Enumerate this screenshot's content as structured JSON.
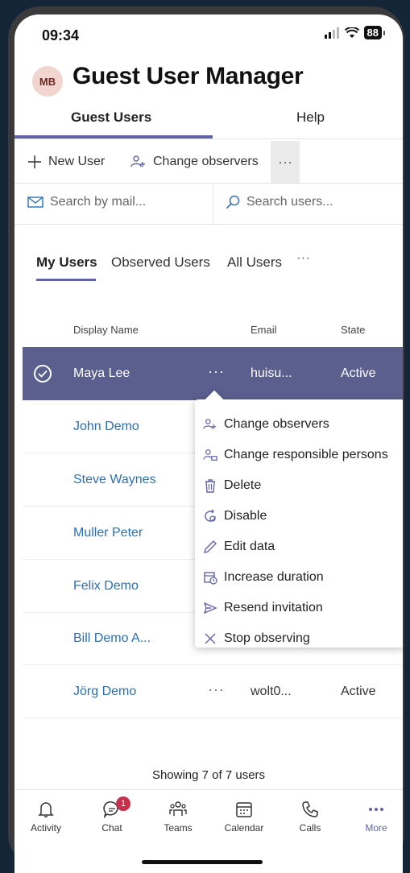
{
  "status": {
    "time": "09:34",
    "battery": "88"
  },
  "header": {
    "avatar_initials": "MB",
    "title": "Guest User Manager"
  },
  "main_tabs": [
    {
      "label": "Guest Users"
    },
    {
      "label": "Help"
    }
  ],
  "toolbar": {
    "new_user": "New User",
    "change_observers": "Change observers",
    "more": "···"
  },
  "search": {
    "mail_placeholder": "Search by mail...",
    "users_placeholder": "Search users..."
  },
  "sub_tabs": [
    {
      "label": "My Users"
    },
    {
      "label": "Observed Users"
    },
    {
      "label": "All Users"
    },
    {
      "label": "···"
    }
  ],
  "table": {
    "headers": {
      "name": "Display Name",
      "email": "Email",
      "state": "State"
    },
    "rows": [
      {
        "name": "Maya Lee",
        "dots": "···",
        "email": "huisu...",
        "state": "Active"
      },
      {
        "name": "John Demo"
      },
      {
        "name": "Steve Waynes"
      },
      {
        "name": "Muller Peter"
      },
      {
        "name": "Felix Demo"
      },
      {
        "name": "Bill Demo A..."
      },
      {
        "name": "Jörg Demo",
        "dots": "···",
        "email": "wolt0...",
        "state": "Active"
      }
    ]
  },
  "context_menu": [
    {
      "label": "Change observers",
      "icon": "people-add-icon"
    },
    {
      "label": "Change responsible persons",
      "icon": "person-key-icon"
    },
    {
      "label": "Delete",
      "icon": "trash-icon"
    },
    {
      "label": "Disable",
      "icon": "disable-icon"
    },
    {
      "label": "Edit data",
      "icon": "pencil-icon"
    },
    {
      "label": "Increase duration",
      "icon": "calendar-clock-icon"
    },
    {
      "label": "Resend invitation",
      "icon": "send-icon"
    },
    {
      "label": "Stop observing",
      "icon": "close-icon"
    }
  ],
  "footer": {
    "showing": "Showing 7 of 7 users"
  },
  "bottom_nav": [
    {
      "label": "Activity",
      "icon": "bell-icon"
    },
    {
      "label": "Chat",
      "icon": "chat-icon",
      "badge": "1"
    },
    {
      "label": "Teams",
      "icon": "teams-icon"
    },
    {
      "label": "Calendar",
      "icon": "calendar-icon"
    },
    {
      "label": "Calls",
      "icon": "phone-icon"
    },
    {
      "label": "More",
      "icon": "more-icon"
    }
  ],
  "colors": {
    "accent": "#6264a7",
    "selected_row": "#5b5f8e",
    "link": "#2e6fb0",
    "badge": "#c4314b"
  }
}
